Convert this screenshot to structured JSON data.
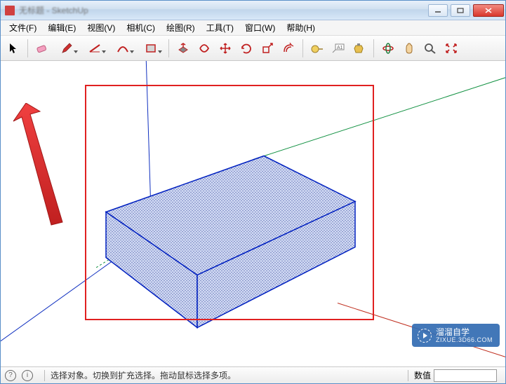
{
  "titlebar": {
    "title": "无标题 - SketchUp"
  },
  "menu": {
    "file": "文件(F)",
    "edit": "编辑(E)",
    "view": "视图(V)",
    "camera": "相机(C)",
    "draw": "绘图(R)",
    "tools": "工具(T)",
    "window": "窗口(W)",
    "help": "帮助(H)"
  },
  "tools": {
    "select": "select",
    "eraser": "eraser",
    "pencil": "pencil",
    "lines": "lines",
    "arcs": "arcs",
    "shapes": "shapes",
    "pushpull": "pushpull",
    "followme": "followme",
    "move": "move",
    "rotate": "rotate",
    "scale": "scale",
    "offset": "offset",
    "tape": "tape",
    "text": "text",
    "paint": "paint",
    "orbit": "orbit",
    "pan": "pan",
    "zoom": "zoom",
    "zoomext": "zoomext"
  },
  "status": {
    "message": "选择对象。切换到扩充选择。拖动鼠标选择多项。",
    "value_label": "数值"
  },
  "watermark": {
    "main": "溜溜自学",
    "sub": "ZIXUE.3D66.COM"
  },
  "colors": {
    "accent_red": "#e02020",
    "edge_blue": "#0020c0",
    "green_axis": "#109040",
    "red_axis": "#c03020",
    "blue_axis": "#1030c0"
  }
}
